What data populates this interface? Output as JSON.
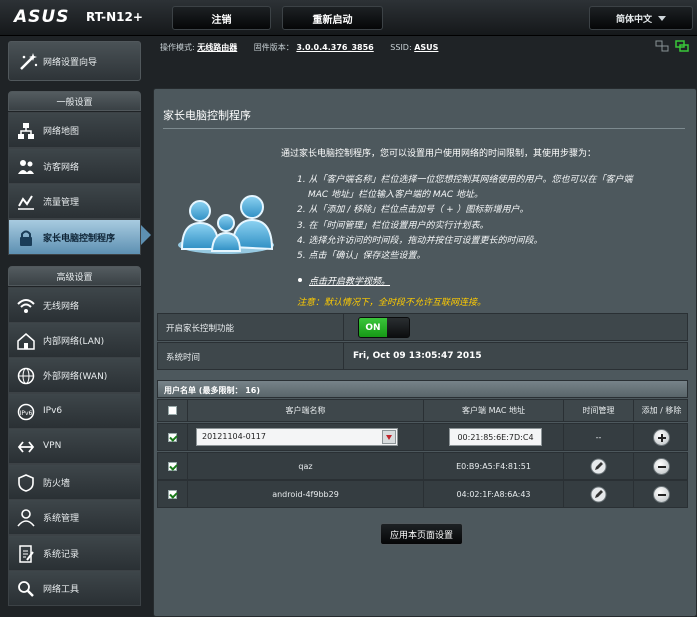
{
  "header": {
    "logo": "ASUS",
    "model": "RT-N12+",
    "logout_label": "注销",
    "reboot_label": "重新启动",
    "language_label": "简体中文"
  },
  "status": {
    "mode_label": "操作模式:",
    "mode_value": "无线路由器",
    "firmware_label": "固件版本：",
    "firmware_value": "3.0.0.4.376_3856",
    "ssid_label": "SSID:",
    "ssid_value": "ASUS"
  },
  "sidebar": {
    "quick_setup": "网络设置向导",
    "general_header": "一般设置",
    "general_items": [
      {
        "label": "网络地图",
        "icon": "network-map-icon"
      },
      {
        "label": "访客网络",
        "icon": "guest-network-icon"
      },
      {
        "label": "流量管理",
        "icon": "traffic-icon"
      },
      {
        "label": "家长电脑控制程序",
        "icon": "lock-icon"
      }
    ],
    "advanced_header": "高级设置",
    "advanced_items": [
      {
        "label": "无线网络",
        "icon": "wifi-icon"
      },
      {
        "label": "内部网络(LAN)",
        "icon": "lan-icon"
      },
      {
        "label": "外部网络(WAN)",
        "icon": "wan-icon"
      },
      {
        "label": "IPv6",
        "icon": "ipv6-icon"
      },
      {
        "label": "VPN",
        "icon": "vpn-icon"
      },
      {
        "label": "防火墙",
        "icon": "firewall-icon"
      },
      {
        "label": "系统管理",
        "icon": "admin-icon"
      },
      {
        "label": "系统记录",
        "icon": "log-icon"
      },
      {
        "label": "网络工具",
        "icon": "tools-icon"
      }
    ]
  },
  "main": {
    "title": "家长电脑控制程序",
    "intro": "通过家长电脑控制程序，您可以设置用户使用网络的时间限制，其使用步骤为：",
    "steps": [
      "1.  从「客户端名称」栏位选择一位您想控制其网络使用的用户。您也可以在「客户端",
      "MAC 地址」栏位输入客户端的 MAC 地址。",
      "2.  从「添加 / 移除」栏位点击加号（ + ）图标新增用户。",
      "3.  在「时间管理」栏位设置用户的实行计划表。",
      "4.  选择允许访问的时间段，拖动并按住可设置更长的时间段。",
      "5.  点击「确认」保存这些设置。"
    ],
    "tutorial_link": "点击开启教学视频。",
    "note": "注意：默认情况下，全时段不允许互联网连接。",
    "enable_label": "开启家长控制功能",
    "toggle_state": "ON",
    "system_time_label": "系统时间",
    "system_time_value": "Fri, Oct 09 13:05:47 2015",
    "client_list_title": "用户名单 (最多限制： 16)",
    "columns": [
      "客户端名称",
      "客户端 MAC 地址",
      "时间管理",
      "添加 / 移除"
    ],
    "new_entry": {
      "device": "20121104-0117",
      "mac": "00:21:85:6E:7D:C4",
      "schedule": "--"
    },
    "clients": [
      {
        "name": "qaz",
        "mac": "E0:B9:A5:F4:81:51"
      },
      {
        "name": "android-4f9bb29",
        "mac": "04:02:1F:A8:6A:43"
      }
    ],
    "apply_label": "应用本页面设置"
  }
}
